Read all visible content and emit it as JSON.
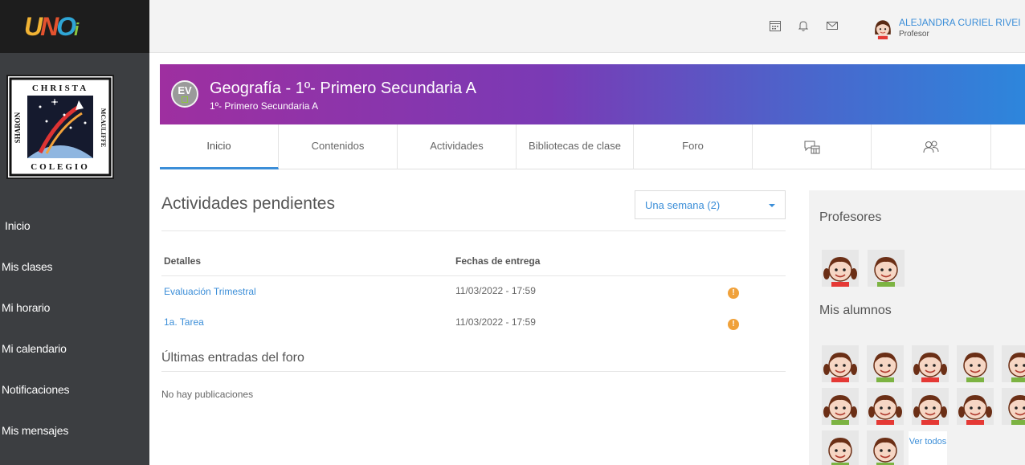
{
  "brand": {
    "logo_text": "UNOi",
    "crest_text": "CHRISTA MCAULIFFE SHARON COLEGIO"
  },
  "sidebar": {
    "items": [
      {
        "label": "Inicio"
      },
      {
        "label": "Mis clases"
      },
      {
        "label": "Mi horario"
      },
      {
        "label": "Mi calendario"
      },
      {
        "label": "Notificaciones"
      },
      {
        "label": "Mis mensajes"
      }
    ]
  },
  "topbar": {
    "user_name": "ALEJANDRA CURIEL RIVEI",
    "user_role": "Profesor",
    "icons": [
      "calendar-icon",
      "bell-icon",
      "mail-icon"
    ]
  },
  "class": {
    "badge": "EV",
    "title": "Geografía  - 1º- Primero Secundaria A",
    "subtitle": "1º- Primero Secundaria A"
  },
  "tabs": [
    {
      "label": "Inicio",
      "active": true
    },
    {
      "label": "Contenidos"
    },
    {
      "label": "Actividades"
    },
    {
      "label": "Bibliotecas de clase"
    },
    {
      "label": "Foro"
    },
    {
      "label": "",
      "icon": "chat-calendar-icon"
    },
    {
      "label": "",
      "icon": "people-icon"
    }
  ],
  "pending": {
    "title": "Actividades pendientes",
    "filter_value": "Una semana (2)",
    "columns": {
      "details": "Detalles",
      "due": "Fechas de entrega"
    },
    "rows": [
      {
        "name": "Evaluación Trimestral",
        "date": "11/03/2022 - 17:59",
        "status_icon": "alert-icon"
      },
      {
        "name": "1a. Tarea",
        "date": "11/03/2022 - 17:59",
        "status_icon": "alert-icon"
      }
    ]
  },
  "forum": {
    "title": "Últimas entradas del foro",
    "empty_text": "No hay publicaciones"
  },
  "people": {
    "teachers_title": "Profesores",
    "students_title": "Mis alumnos",
    "see_all": "Ver todos",
    "teachers_count": 2,
    "students_count": 12
  },
  "colors": {
    "sidebar_bg": "#3c3e41",
    "accent": "#3b8ed8",
    "header_gradient_start": "#9e2fa0",
    "header_gradient_end": "#2d86dc",
    "alert": "#f0a13a"
  }
}
